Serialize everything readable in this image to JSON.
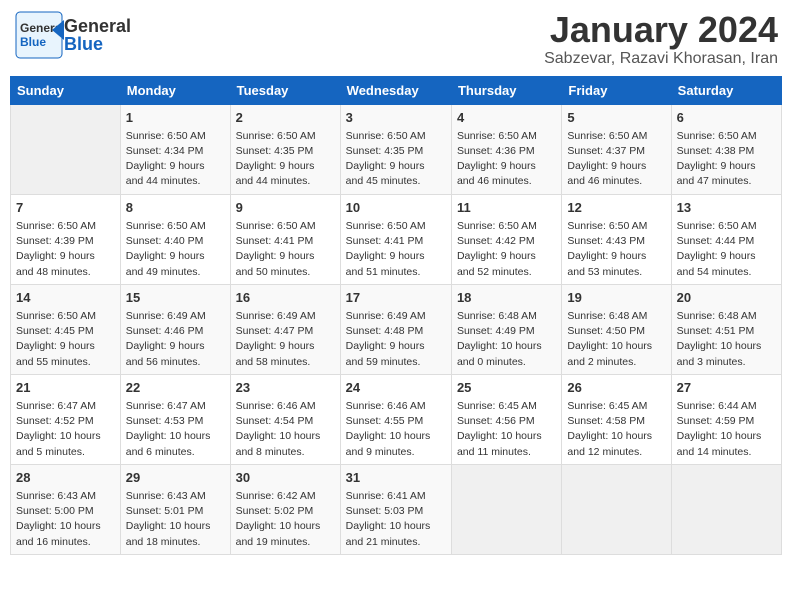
{
  "header": {
    "logo_general": "General",
    "logo_blue": "Blue",
    "title": "January 2024",
    "subtitle": "Sabzevar, Razavi Khorasan, Iran"
  },
  "days_of_week": [
    "Sunday",
    "Monday",
    "Tuesday",
    "Wednesday",
    "Thursday",
    "Friday",
    "Saturday"
  ],
  "weeks": [
    [
      {
        "day": "",
        "info": ""
      },
      {
        "day": "1",
        "info": "Sunrise: 6:50 AM\nSunset: 4:34 PM\nDaylight: 9 hours\nand 44 minutes."
      },
      {
        "day": "2",
        "info": "Sunrise: 6:50 AM\nSunset: 4:35 PM\nDaylight: 9 hours\nand 44 minutes."
      },
      {
        "day": "3",
        "info": "Sunrise: 6:50 AM\nSunset: 4:35 PM\nDaylight: 9 hours\nand 45 minutes."
      },
      {
        "day": "4",
        "info": "Sunrise: 6:50 AM\nSunset: 4:36 PM\nDaylight: 9 hours\nand 46 minutes."
      },
      {
        "day": "5",
        "info": "Sunrise: 6:50 AM\nSunset: 4:37 PM\nDaylight: 9 hours\nand 46 minutes."
      },
      {
        "day": "6",
        "info": "Sunrise: 6:50 AM\nSunset: 4:38 PM\nDaylight: 9 hours\nand 47 minutes."
      }
    ],
    [
      {
        "day": "7",
        "info": "Sunrise: 6:50 AM\nSunset: 4:39 PM\nDaylight: 9 hours\nand 48 minutes."
      },
      {
        "day": "8",
        "info": "Sunrise: 6:50 AM\nSunset: 4:40 PM\nDaylight: 9 hours\nand 49 minutes."
      },
      {
        "day": "9",
        "info": "Sunrise: 6:50 AM\nSunset: 4:41 PM\nDaylight: 9 hours\nand 50 minutes."
      },
      {
        "day": "10",
        "info": "Sunrise: 6:50 AM\nSunset: 4:41 PM\nDaylight: 9 hours\nand 51 minutes."
      },
      {
        "day": "11",
        "info": "Sunrise: 6:50 AM\nSunset: 4:42 PM\nDaylight: 9 hours\nand 52 minutes."
      },
      {
        "day": "12",
        "info": "Sunrise: 6:50 AM\nSunset: 4:43 PM\nDaylight: 9 hours\nand 53 minutes."
      },
      {
        "day": "13",
        "info": "Sunrise: 6:50 AM\nSunset: 4:44 PM\nDaylight: 9 hours\nand 54 minutes."
      }
    ],
    [
      {
        "day": "14",
        "info": "Sunrise: 6:50 AM\nSunset: 4:45 PM\nDaylight: 9 hours\nand 55 minutes."
      },
      {
        "day": "15",
        "info": "Sunrise: 6:49 AM\nSunset: 4:46 PM\nDaylight: 9 hours\nand 56 minutes."
      },
      {
        "day": "16",
        "info": "Sunrise: 6:49 AM\nSunset: 4:47 PM\nDaylight: 9 hours\nand 58 minutes."
      },
      {
        "day": "17",
        "info": "Sunrise: 6:49 AM\nSunset: 4:48 PM\nDaylight: 9 hours\nand 59 minutes."
      },
      {
        "day": "18",
        "info": "Sunrise: 6:48 AM\nSunset: 4:49 PM\nDaylight: 10 hours\nand 0 minutes."
      },
      {
        "day": "19",
        "info": "Sunrise: 6:48 AM\nSunset: 4:50 PM\nDaylight: 10 hours\nand 2 minutes."
      },
      {
        "day": "20",
        "info": "Sunrise: 6:48 AM\nSunset: 4:51 PM\nDaylight: 10 hours\nand 3 minutes."
      }
    ],
    [
      {
        "day": "21",
        "info": "Sunrise: 6:47 AM\nSunset: 4:52 PM\nDaylight: 10 hours\nand 5 minutes."
      },
      {
        "day": "22",
        "info": "Sunrise: 6:47 AM\nSunset: 4:53 PM\nDaylight: 10 hours\nand 6 minutes."
      },
      {
        "day": "23",
        "info": "Sunrise: 6:46 AM\nSunset: 4:54 PM\nDaylight: 10 hours\nand 8 minutes."
      },
      {
        "day": "24",
        "info": "Sunrise: 6:46 AM\nSunset: 4:55 PM\nDaylight: 10 hours\nand 9 minutes."
      },
      {
        "day": "25",
        "info": "Sunrise: 6:45 AM\nSunset: 4:56 PM\nDaylight: 10 hours\nand 11 minutes."
      },
      {
        "day": "26",
        "info": "Sunrise: 6:45 AM\nSunset: 4:58 PM\nDaylight: 10 hours\nand 12 minutes."
      },
      {
        "day": "27",
        "info": "Sunrise: 6:44 AM\nSunset: 4:59 PM\nDaylight: 10 hours\nand 14 minutes."
      }
    ],
    [
      {
        "day": "28",
        "info": "Sunrise: 6:43 AM\nSunset: 5:00 PM\nDaylight: 10 hours\nand 16 minutes."
      },
      {
        "day": "29",
        "info": "Sunrise: 6:43 AM\nSunset: 5:01 PM\nDaylight: 10 hours\nand 18 minutes."
      },
      {
        "day": "30",
        "info": "Sunrise: 6:42 AM\nSunset: 5:02 PM\nDaylight: 10 hours\nand 19 minutes."
      },
      {
        "day": "31",
        "info": "Sunrise: 6:41 AM\nSunset: 5:03 PM\nDaylight: 10 hours\nand 21 minutes."
      },
      {
        "day": "",
        "info": ""
      },
      {
        "day": "",
        "info": ""
      },
      {
        "day": "",
        "info": ""
      }
    ]
  ]
}
